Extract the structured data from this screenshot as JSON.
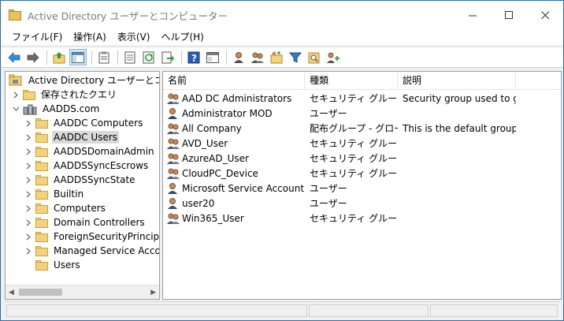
{
  "window": {
    "title": "Active Directory ユーザーとコンピューター"
  },
  "menu": [
    "ファイル(F)",
    "操作(A)",
    "表示(V)",
    "ヘルプ(H)"
  ],
  "toolbar": {
    "icons": [
      "back-arrow-icon",
      "forward-arrow-icon",
      "up-folder-icon",
      "show-tree-icon",
      "properties-icon",
      "export-list-icon",
      "refresh-icon",
      "export-icon",
      "help-icon",
      "console-icon",
      "new-user-icon",
      "new-group-icon",
      "new-ou-icon",
      "filter-icon",
      "find-icon",
      "add-to-group-icon"
    ]
  },
  "tree": {
    "root": "Active Directory ユーザーとコンピュ",
    "saved_queries": "保存されたクエリ",
    "domain": "AADDS.com",
    "children": [
      "AADDC Computers",
      "AADDC Users",
      "AADDSDomainAdmin",
      "AADDSSyncEscrows",
      "AADDSSyncState",
      "Builtin",
      "Computers",
      "Domain Controllers",
      "ForeignSecurityPrincipals",
      "Managed Service Accour",
      "Users"
    ],
    "selected": "AADDC Users"
  },
  "list": {
    "columns": [
      "名前",
      "種類",
      "説明"
    ],
    "rows": [
      {
        "name": "AAD DC Administrators",
        "type": "セキュリティ グループ -...",
        "desc": "Security group used to g...",
        "icon": "group-icon"
      },
      {
        "name": "Administrator MOD",
        "type": "ユーザー",
        "desc": "",
        "icon": "user-icon"
      },
      {
        "name": "All Company",
        "type": "配布グループ - グロー...",
        "desc": "This is the default group...",
        "icon": "group-icon"
      },
      {
        "name": "AVD_User",
        "type": "セキュリティ グループ -...",
        "desc": "",
        "icon": "group-icon"
      },
      {
        "name": "AzureAD_User",
        "type": "セキュリティ グループ -...",
        "desc": "",
        "icon": "group-icon"
      },
      {
        "name": "CloudPC_Device",
        "type": "セキュリティ グループ -...",
        "desc": "",
        "icon": "group-icon"
      },
      {
        "name": "Microsoft Service Account",
        "type": "ユーザー",
        "desc": "",
        "icon": "user-icon"
      },
      {
        "name": "user20",
        "type": "ユーザー",
        "desc": "",
        "icon": "user-icon"
      },
      {
        "name": "Win365_User",
        "type": "セキュリティ グループ -...",
        "desc": "",
        "icon": "group-icon"
      }
    ]
  },
  "colors": {
    "folder": "#f3d27a",
    "selection": "#d9d9d9",
    "window_border": "#2b6bb0"
  }
}
